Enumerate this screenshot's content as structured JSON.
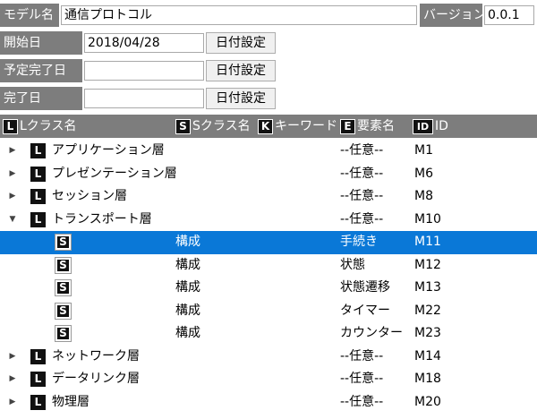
{
  "form": {
    "model_label": "モデル名",
    "model_value": "通信プロトコル",
    "version_label": "バージョン",
    "version_value": "0.0.1",
    "start_label": "開始日",
    "start_value": "2018/04/28",
    "planned_label": "予定完了日",
    "planned_value": "",
    "done_label": "完了日",
    "done_value": "",
    "date_button": "日付設定"
  },
  "header": {
    "l_badge": "L",
    "l_label": "Lクラス名",
    "s_badge": "S",
    "s_label": "Sクラス名",
    "k_badge": "K",
    "k_label": "キーワード",
    "e_badge": "E",
    "e_label": "要素名",
    "id_badge": "ID",
    "id_label": "ID"
  },
  "icons": {
    "collapsed": "▶",
    "expanded": "▼"
  },
  "rows": [
    {
      "name": "アプリケーション層",
      "element": "--任意--",
      "id": "M1"
    },
    {
      "name": "プレゼンテーション層",
      "element": "--任意--",
      "id": "M6"
    },
    {
      "name": "セッション層",
      "element": "--任意--",
      "id": "M8"
    },
    {
      "name": "トランスポート層",
      "element": "--任意--",
      "id": "M10"
    },
    {
      "sclass": "構成",
      "element": "手続き",
      "id": "M11"
    },
    {
      "sclass": "構成",
      "element": "状態",
      "id": "M12"
    },
    {
      "sclass": "構成",
      "element": "状態遷移",
      "id": "M13"
    },
    {
      "sclass": "構成",
      "element": "タイマー",
      "id": "M22"
    },
    {
      "sclass": "構成",
      "element": "カウンター",
      "id": "M23"
    },
    {
      "name": "ネットワーク層",
      "element": "--任意--",
      "id": "M14"
    },
    {
      "name": "データリンク層",
      "element": "--任意--",
      "id": "M18"
    },
    {
      "name": "物理層",
      "element": "--任意--",
      "id": "M20"
    }
  ]
}
